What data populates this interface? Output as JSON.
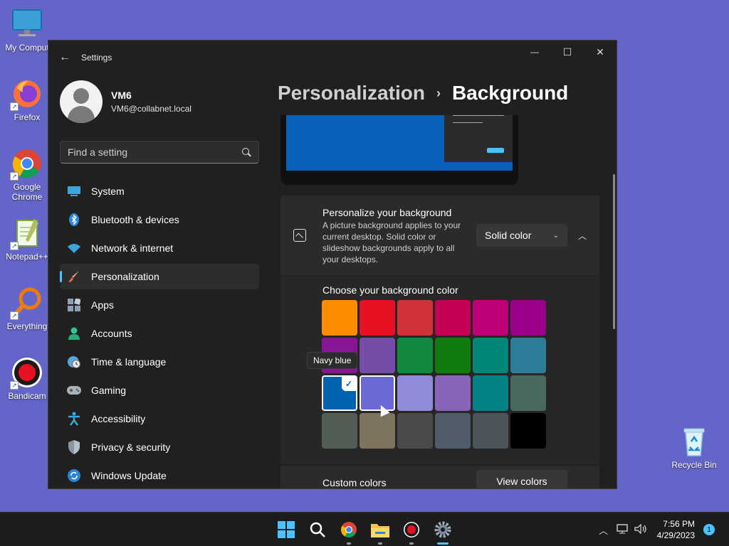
{
  "desktop": {
    "icons": [
      {
        "label": "My Comput",
        "icon": "computer-icon"
      },
      {
        "label": "Firefox",
        "icon": "firefox-icon"
      },
      {
        "label": "Google Chrome",
        "icon": "chrome-icon"
      },
      {
        "label": "Notepad++",
        "icon": "notepadpp-icon"
      },
      {
        "label": "Everything",
        "icon": "everything-icon"
      },
      {
        "label": "Bandicam",
        "icon": "bandicam-icon"
      },
      {
        "label": "Recycle Bin",
        "icon": "recycle-bin-icon"
      }
    ]
  },
  "window": {
    "title": "Settings",
    "controls": {
      "minimize": "—",
      "maximize": "☐",
      "close": "✕"
    }
  },
  "profile": {
    "name": "VM6",
    "email": "VM6@collabnet.local"
  },
  "search": {
    "placeholder": "Find a setting"
  },
  "nav": {
    "items": [
      {
        "label": "System",
        "icon": "system-icon",
        "active": false
      },
      {
        "label": "Bluetooth & devices",
        "icon": "bluetooth-icon",
        "active": false
      },
      {
        "label": "Network & internet",
        "icon": "wifi-icon",
        "active": false
      },
      {
        "label": "Personalization",
        "icon": "brush-icon",
        "active": true
      },
      {
        "label": "Apps",
        "icon": "apps-icon",
        "active": false
      },
      {
        "label": "Accounts",
        "icon": "accounts-icon",
        "active": false
      },
      {
        "label": "Time & language",
        "icon": "clock-globe-icon",
        "active": false
      },
      {
        "label": "Gaming",
        "icon": "gamepad-icon",
        "active": false
      },
      {
        "label": "Accessibility",
        "icon": "accessibility-icon",
        "active": false
      },
      {
        "label": "Privacy & security",
        "icon": "shield-icon",
        "active": false
      },
      {
        "label": "Windows Update",
        "icon": "update-icon",
        "active": false
      }
    ]
  },
  "breadcrumb": {
    "parent": "Personalization",
    "separator": "›",
    "current": "Background"
  },
  "background_card": {
    "title": "Personalize your background",
    "description": "A picture background applies to your current desktop. Solid color or slideshow backgrounds apply to all your desktops.",
    "dropdown_value": "Solid color",
    "collapse_icon": "chevron-up-icon"
  },
  "colors": {
    "title": "Choose your background color",
    "selected": "#0063b1",
    "hover_tooltip": "Navy blue",
    "swatches": [
      [
        "#ff8c00",
        "#e81123",
        "#d13438",
        "#c30052",
        "#bf0077",
        "#9a0089"
      ],
      [
        "#881798",
        "#744da9",
        "#10893e",
        "#107c10",
        "#018574",
        "#2d7d9a"
      ],
      [
        "#0063b1",
        "#6b69d6",
        "#8e8cd8",
        "#8764b8",
        "#038387",
        "#486860"
      ],
      [
        "#525e54",
        "#7e735f",
        "#4c4a48",
        "#515c6b",
        "#4a5459",
        "#000000"
      ]
    ]
  },
  "custom_colors": {
    "label": "Custom colors",
    "button": "View colors"
  },
  "taskbar": {
    "apps": [
      "start-icon",
      "search-icon",
      "chrome-icon",
      "file-explorer-icon",
      "bandicam-icon",
      "settings-icon"
    ],
    "time": "7:56 PM",
    "date": "4/29/2023",
    "notification_count": "1"
  }
}
